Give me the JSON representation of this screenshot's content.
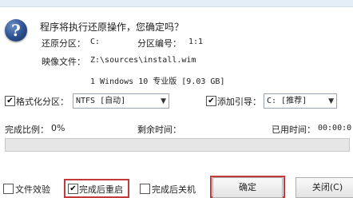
{
  "dialog": {
    "question": "程序将执行还原操作，您确定吗？",
    "restore_partition_label": "还原分区：",
    "restore_partition_value": "C:",
    "partition_number_label": "分区编号：",
    "partition_number_value": "1:1",
    "image_file_label": "映像文件：",
    "image_file_value": "Z:\\sources\\install.wim",
    "image_version": "1 Windows 10 专业版 [9.03 GB]"
  },
  "options": {
    "format_checkbox_label": "格式化分区：",
    "format_checked": true,
    "format_select_value": "NTFS [自动]",
    "boot_checkbox_label": "添加引导：",
    "boot_checked": true,
    "boot_select_value": "C: [推荐]"
  },
  "status": {
    "completion_label": "完成比例：",
    "completion_value": "0%",
    "remaining_label": "剩余时间：",
    "elapsed_label": "已用时间：",
    "elapsed_value": "00:00:0"
  },
  "progress": {
    "fraction": 0
  },
  "footer": {
    "verify_label": "文件效验",
    "verify_checked": false,
    "restart_label": "完成后重启",
    "restart_checked": true,
    "shutdown_label": "完成后关机",
    "shutdown_checked": false,
    "confirm_label": "确定",
    "close_label": "关闭(C)"
  },
  "colors": {
    "highlight_border": "#c23a3a",
    "progress_fill": "#3a9b3a"
  }
}
